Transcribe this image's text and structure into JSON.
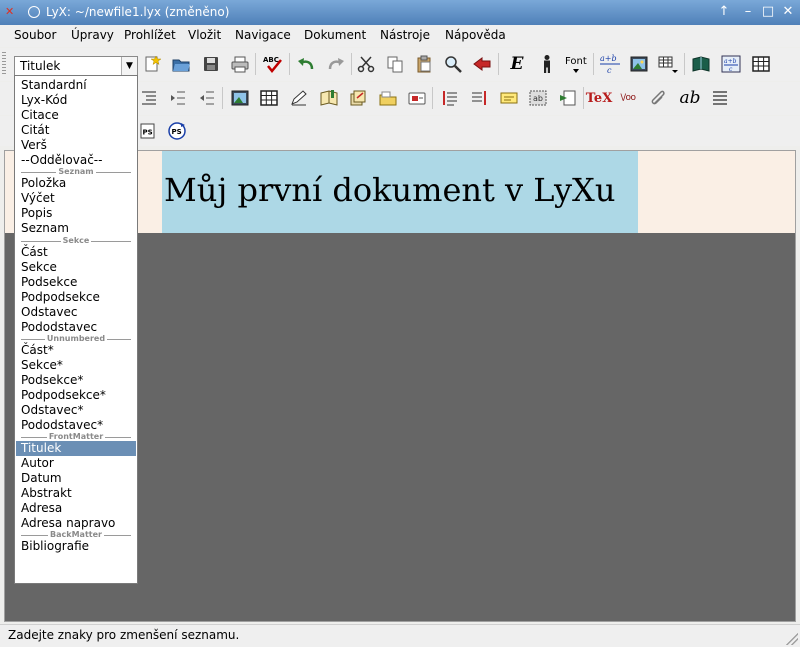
{
  "window": {
    "title": "LyX: ~/newfile1.lyx (změněno)",
    "app_icon_glyph": "✕",
    "buttons": {
      "help": "↑",
      "minimize": "–",
      "maximize": "□",
      "close": "✕"
    }
  },
  "menu": [
    "Soubor",
    "Úpravy",
    "Prohlížet",
    "Vložit",
    "Navigace",
    "Dokument",
    "Nástroje",
    "Nápověda"
  ],
  "layout_combo": {
    "value": "Titulek",
    "arrow": "▼"
  },
  "toolbar1": {
    "icons": [
      "new-document",
      "open-folder",
      "save",
      "print",
      "spellcheck",
      "undo",
      "redo",
      "cut",
      "copy",
      "paste",
      "find-replace",
      "back",
      "emphasis",
      "noun",
      "font",
      "math",
      "insert-graphics",
      "insert-table-menu",
      "table-of-contents",
      "math-panel",
      "table-grid"
    ],
    "texts": {
      "spellcheck": "ABC",
      "emphasis": "E",
      "font": "Font",
      "math_top": "a+b",
      "math_bottom": "c",
      "math_panel_top": "a+b",
      "math_panel_bottom": "c"
    }
  },
  "toolbar2": {
    "icons": [
      "list",
      "indent-more",
      "indent-less",
      "insert-image",
      "insert-table",
      "insert-note",
      "insert-label",
      "insert-reference",
      "insert-citation",
      "insert-index",
      "insert-float",
      "insert-footnote",
      "insert-marginal-note",
      "insert-comment",
      "insert-box",
      "insert-external",
      "insert-tex",
      "insert-url",
      "attach",
      "typewriter",
      "justify"
    ],
    "texts": {
      "tex": "TeX",
      "url": "\\/oo",
      "ab": "ab"
    }
  },
  "toolbar3": {
    "icons": [
      "view-ps",
      "update-ps"
    ],
    "texts": {
      "ps": "PS"
    }
  },
  "document": {
    "title_paragraph": "Můj první dokument v LyXu"
  },
  "dropdown": {
    "items": [
      {
        "type": "item",
        "label": "Standardní"
      },
      {
        "type": "item",
        "label": "Lyx-Kód"
      },
      {
        "type": "item",
        "label": "Citace"
      },
      {
        "type": "item",
        "label": "Citát"
      },
      {
        "type": "item",
        "label": "Verš"
      },
      {
        "type": "item",
        "label": "--Oddělovač--"
      },
      {
        "type": "sep",
        "label": "Seznam"
      },
      {
        "type": "item",
        "label": "Položka"
      },
      {
        "type": "item",
        "label": "Výčet"
      },
      {
        "type": "item",
        "label": "Popis"
      },
      {
        "type": "item",
        "label": "Seznam"
      },
      {
        "type": "sep",
        "label": "Sekce"
      },
      {
        "type": "item",
        "label": "Část"
      },
      {
        "type": "item",
        "label": "Sekce"
      },
      {
        "type": "item",
        "label": "Podsekce"
      },
      {
        "type": "item",
        "label": "Podpodsekce"
      },
      {
        "type": "item",
        "label": "Odstavec"
      },
      {
        "type": "item",
        "label": "Pododstavec"
      },
      {
        "type": "sep",
        "label": "Unnumbered"
      },
      {
        "type": "item",
        "label": "Část*"
      },
      {
        "type": "item",
        "label": "Sekce*"
      },
      {
        "type": "item",
        "label": "Podsekce*"
      },
      {
        "type": "item",
        "label": "Podpodsekce*"
      },
      {
        "type": "item",
        "label": "Odstavec*"
      },
      {
        "type": "item",
        "label": "Pododstavec*"
      },
      {
        "type": "sep",
        "label": "FrontMatter"
      },
      {
        "type": "item",
        "label": "Titulek",
        "selected": true
      },
      {
        "type": "item",
        "label": "Autor"
      },
      {
        "type": "item",
        "label": "Datum"
      },
      {
        "type": "item",
        "label": "Abstrakt"
      },
      {
        "type": "item",
        "label": "Adresa"
      },
      {
        "type": "item",
        "label": "Adresa napravo"
      },
      {
        "type": "sep",
        "label": "BackMatter"
      },
      {
        "type": "item",
        "label": "Bibliografie"
      }
    ]
  },
  "status": {
    "message": "Zadejte znaky pro zmenšení seznamu."
  },
  "colors": {
    "titlebar": "#5a8cc6",
    "selection": "#6b8fb5",
    "title_paragraph_bg": "#add8e6",
    "page_bg": "#faefe5",
    "workarea": "#666666"
  }
}
